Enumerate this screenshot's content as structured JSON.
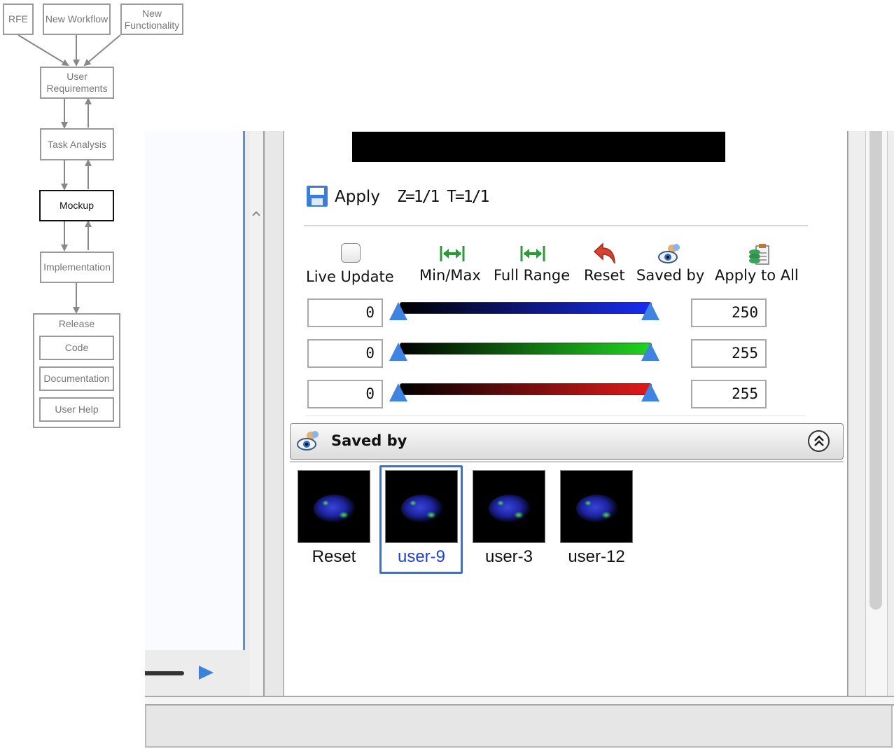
{
  "workflow": {
    "rfe": "RFE",
    "new_workflow": "New Workflow",
    "new_functionality": "New Functionality",
    "user_requirements": "User Requirements",
    "task_analysis": "Task Analysis",
    "mockup": "Mockup",
    "implementation": "Implementation",
    "release": "Release",
    "code": "Code",
    "documentation": "Documentation",
    "user_help": "User Help"
  },
  "toolbar": {
    "apply_label": "Apply",
    "position_label": "Z=1/1 T=1/1"
  },
  "controls": {
    "live_update": "Live Update",
    "min_max": "Min/Max",
    "full_range": "Full Range",
    "reset": "Reset",
    "saved_by": "Saved by",
    "apply_to_all": "Apply to All",
    "live_update_checked": false
  },
  "channels": [
    {
      "min": "0",
      "max": "250",
      "color": "#1a2cf0"
    },
    {
      "min": "0",
      "max": "255",
      "color": "#22d422"
    },
    {
      "min": "0",
      "max": "255",
      "color": "#e31a1a"
    }
  ],
  "saved_by_panel": {
    "title": "Saved by",
    "thumbnails": [
      {
        "label": "Reset",
        "selected": false
      },
      {
        "label": "user-9",
        "selected": true
      },
      {
        "label": "user-3",
        "selected": false
      },
      {
        "label": "user-12",
        "selected": false
      }
    ]
  },
  "colors": {
    "selection": "#4a6fb5",
    "selected_text": "#1f3fd6",
    "accent_blue": "#3c82d8"
  }
}
